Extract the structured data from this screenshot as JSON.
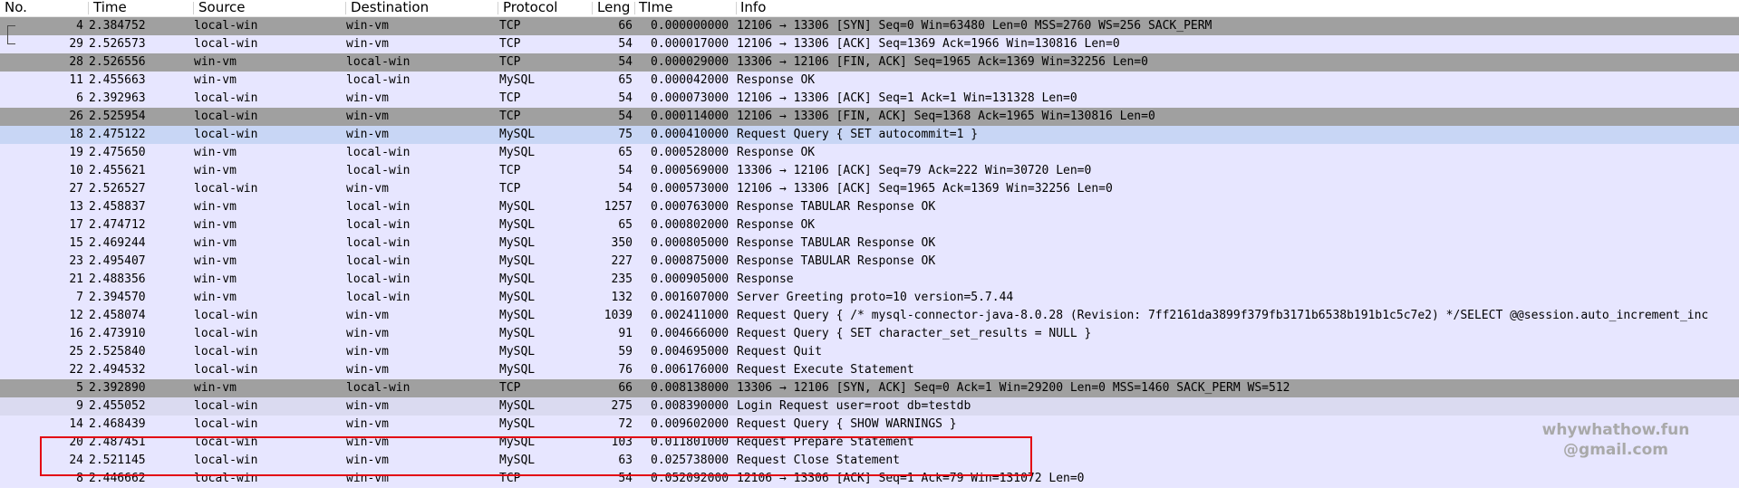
{
  "columns": {
    "no": "No.",
    "time": "Time",
    "source": "Source",
    "destination": "Destination",
    "protocol": "Protocol",
    "length": "Leng",
    "delta": "TIme",
    "info": "Info"
  },
  "packets": [
    {
      "no": "4",
      "time": "2.384752",
      "source": "local-win",
      "destination": "win-vm",
      "protocol": "TCP",
      "length": "66",
      "delta": "0.000000000",
      "info": "12106 → 13306 [SYN] Seq=0 Win=63480 Len=0 MSS=2760 WS=256 SACK_PERM"
    },
    {
      "no": "29",
      "time": "2.526573",
      "source": "local-win",
      "destination": "win-vm",
      "protocol": "TCP",
      "length": "54",
      "delta": "0.000017000",
      "info": "12106 → 13306 [ACK] Seq=1369 Ack=1966 Win=130816 Len=0"
    },
    {
      "no": "28",
      "time": "2.526556",
      "source": "win-vm",
      "destination": "local-win",
      "protocol": "TCP",
      "length": "54",
      "delta": "0.000029000",
      "info": "13306 → 12106 [FIN, ACK] Seq=1965 Ack=1369 Win=32256 Len=0"
    },
    {
      "no": "11",
      "time": "2.455663",
      "source": "win-vm",
      "destination": "local-win",
      "protocol": "MySQL",
      "length": "65",
      "delta": "0.000042000",
      "info": "Response  OK"
    },
    {
      "no": "6",
      "time": "2.392963",
      "source": "local-win",
      "destination": "win-vm",
      "protocol": "TCP",
      "length": "54",
      "delta": "0.000073000",
      "info": "12106 → 13306 [ACK] Seq=1 Ack=1 Win=131328 Len=0"
    },
    {
      "no": "26",
      "time": "2.525954",
      "source": "local-win",
      "destination": "win-vm",
      "protocol": "TCP",
      "length": "54",
      "delta": "0.000114000",
      "info": "12106 → 13306 [FIN, ACK] Seq=1368 Ack=1965 Win=130816 Len=0"
    },
    {
      "no": "18",
      "time": "2.475122",
      "source": "local-win",
      "destination": "win-vm",
      "protocol": "MySQL",
      "length": "75",
      "delta": "0.000410000",
      "info": "Request Query { SET autocommit=1 }"
    },
    {
      "no": "19",
      "time": "2.475650",
      "source": "win-vm",
      "destination": "local-win",
      "protocol": "MySQL",
      "length": "65",
      "delta": "0.000528000",
      "info": "Response  OK"
    },
    {
      "no": "10",
      "time": "2.455621",
      "source": "win-vm",
      "destination": "local-win",
      "protocol": "TCP",
      "length": "54",
      "delta": "0.000569000",
      "info": "13306 → 12106 [ACK] Seq=79 Ack=222 Win=30720 Len=0"
    },
    {
      "no": "27",
      "time": "2.526527",
      "source": "local-win",
      "destination": "win-vm",
      "protocol": "TCP",
      "length": "54",
      "delta": "0.000573000",
      "info": "12106 → 13306 [ACK] Seq=1965 Ack=1369 Win=32256 Len=0"
    },
    {
      "no": "13",
      "time": "2.458837",
      "source": "win-vm",
      "destination": "local-win",
      "protocol": "MySQL",
      "length": "1257",
      "delta": "0.000763000",
      "info": "Response TABULAR Response  OK"
    },
    {
      "no": "17",
      "time": "2.474712",
      "source": "win-vm",
      "destination": "local-win",
      "protocol": "MySQL",
      "length": "65",
      "delta": "0.000802000",
      "info": "Response  OK"
    },
    {
      "no": "15",
      "time": "2.469244",
      "source": "win-vm",
      "destination": "local-win",
      "protocol": "MySQL",
      "length": "350",
      "delta": "0.000805000",
      "info": "Response TABULAR Response  OK"
    },
    {
      "no": "23",
      "time": "2.495407",
      "source": "win-vm",
      "destination": "local-win",
      "protocol": "MySQL",
      "length": "227",
      "delta": "0.000875000",
      "info": "Response TABULAR Response  OK"
    },
    {
      "no": "21",
      "time": "2.488356",
      "source": "win-vm",
      "destination": "local-win",
      "protocol": "MySQL",
      "length": "235",
      "delta": "0.000905000",
      "info": "Response"
    },
    {
      "no": "7",
      "time": "2.394570",
      "source": "win-vm",
      "destination": "local-win",
      "protocol": "MySQL",
      "length": "132",
      "delta": "0.001607000",
      "info": "Server Greeting  proto=10 version=5.7.44"
    },
    {
      "no": "12",
      "time": "2.458074",
      "source": "local-win",
      "destination": "win-vm",
      "protocol": "MySQL",
      "length": "1039",
      "delta": "0.002411000",
      "info": "Request Query { /* mysql-connector-java-8.0.28 (Revision: 7ff2161da3899f379fb3171b6538b191b1c5c7e2) */SELECT  @@session.auto_increment_inc"
    },
    {
      "no": "16",
      "time": "2.473910",
      "source": "local-win",
      "destination": "win-vm",
      "protocol": "MySQL",
      "length": "91",
      "delta": "0.004666000",
      "info": "Request Query { SET character_set_results = NULL }"
    },
    {
      "no": "25",
      "time": "2.525840",
      "source": "local-win",
      "destination": "win-vm",
      "protocol": "MySQL",
      "length": "59",
      "delta": "0.004695000",
      "info": "Request Quit"
    },
    {
      "no": "22",
      "time": "2.494532",
      "source": "local-win",
      "destination": "win-vm",
      "protocol": "MySQL",
      "length": "76",
      "delta": "0.006176000",
      "info": "Request Execute Statement"
    },
    {
      "no": "5",
      "time": "2.392890",
      "source": "win-vm",
      "destination": "local-win",
      "protocol": "TCP",
      "length": "66",
      "delta": "0.008138000",
      "info": "13306 → 12106 [SYN, ACK] Seq=0 Ack=1 Win=29200 Len=0 MSS=1460 SACK_PERM WS=512"
    },
    {
      "no": "9",
      "time": "2.455052",
      "source": "local-win",
      "destination": "win-vm",
      "protocol": "MySQL",
      "length": "275",
      "delta": "0.008390000",
      "info": "Login Request user=root db=testdb"
    },
    {
      "no": "14",
      "time": "2.468439",
      "source": "local-win",
      "destination": "win-vm",
      "protocol": "MySQL",
      "length": "72",
      "delta": "0.009602000",
      "info": "Request Query { SHOW WARNINGS }"
    },
    {
      "no": "20",
      "time": "2.487451",
      "source": "local-win",
      "destination": "win-vm",
      "protocol": "MySQL",
      "length": "103",
      "delta": "0.011801000",
      "info": "Request Prepare Statement"
    },
    {
      "no": "24",
      "time": "2.521145",
      "source": "local-win",
      "destination": "win-vm",
      "protocol": "MySQL",
      "length": "63",
      "delta": "0.025738000",
      "info": "Request Close Statement"
    },
    {
      "no": "8",
      "time": "2.446662",
      "source": "local-win",
      "destination": "win-vm",
      "protocol": "TCP",
      "length": "54",
      "delta": "0.052092000",
      "info": "12106 → 13306 [ACK] Seq=1 Ack=79 Win=131072 Len=0"
    }
  ],
  "row_styles": [
    "gray",
    "plain",
    "gray",
    "plain",
    "plain",
    "gray",
    "sel",
    "plain",
    "plain",
    "plain",
    "plain",
    "plain",
    "plain",
    "plain",
    "plain",
    "plain",
    "plain",
    "plain",
    "plain",
    "plain",
    "gray",
    "alt",
    "plain",
    "plain",
    "plain",
    "plain"
  ],
  "colors": {
    "row_default": "#e7e6ff",
    "row_gray": "#a0a0a0",
    "row_selected": "#c8d6f5",
    "highlight_box": "#e30613"
  },
  "watermark": {
    "line1": "whywhathow.fun",
    "line2": "@gmail.com"
  }
}
